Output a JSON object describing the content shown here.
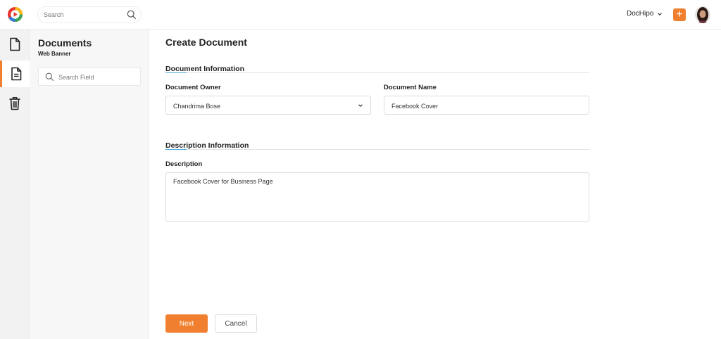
{
  "app": {
    "logo": "dochipo-logo-icon",
    "accent_color": "#f0802f",
    "link_accent_color": "#4aa8d8"
  },
  "topbar": {
    "search_placeholder": "Search",
    "account_label": "DocHipo",
    "add_icon": "plus-icon"
  },
  "rail": {
    "items": [
      {
        "icon": "file-icon",
        "active": false
      },
      {
        "icon": "document-icon",
        "active": true
      },
      {
        "icon": "trash-icon",
        "active": false
      }
    ]
  },
  "panel": {
    "title": "Documents",
    "subtitle": "Web Banner",
    "search_placeholder": "Search Field"
  },
  "main": {
    "title": "Create Document",
    "document_info": {
      "heading": "Document Information",
      "owner_label": "Document Owner",
      "owner_value": "Chandrima Bose",
      "name_label": "Document Name",
      "name_value": "Facebook Cover"
    },
    "description_info": {
      "heading": "Description Information",
      "description_label": "Description",
      "description_value": "Facebook Cover for Business Page"
    },
    "actions": {
      "next_label": "Next",
      "cancel_label": "Cancel"
    }
  }
}
